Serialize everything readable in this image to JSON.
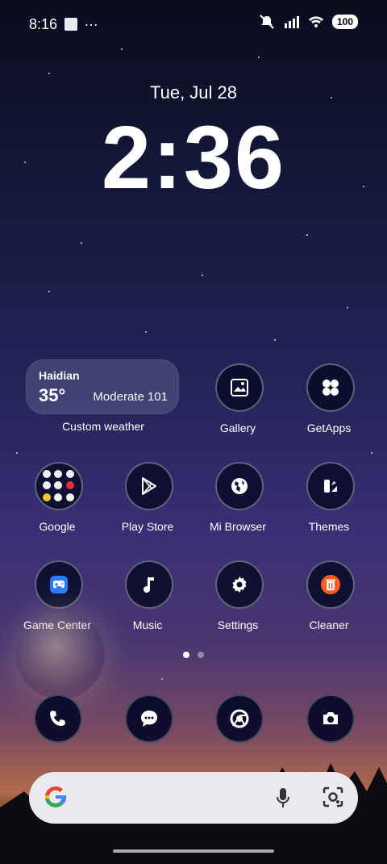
{
  "status": {
    "time": "8:16",
    "dots": "…",
    "battery": "100"
  },
  "home": {
    "date": "Tue, Jul 28",
    "clock": "2:36"
  },
  "weather": {
    "city": "Haidian",
    "temp": "35°",
    "aqi": "Moderate 101",
    "label": "Custom weather"
  },
  "apps": [
    {
      "name": "Gallery"
    },
    {
      "name": "GetApps"
    },
    {
      "name": "Google"
    },
    {
      "name": "Play Store"
    },
    {
      "name": "Mi Browser"
    },
    {
      "name": "Themes"
    },
    {
      "name": "Game Center"
    },
    {
      "name": "Music"
    },
    {
      "name": "Settings"
    },
    {
      "name": "Cleaner"
    }
  ],
  "pager": {
    "pages": 2,
    "active": 0
  },
  "dock": [
    "phone-icon",
    "messages-icon",
    "chrome-icon",
    "camera-icon"
  ],
  "colors": {
    "cleaner_orange": "#ff5a1f",
    "game_blue": "#2a7cff",
    "moon_yellow": "#ffcc33",
    "search_bg": "#e9e9ee"
  }
}
